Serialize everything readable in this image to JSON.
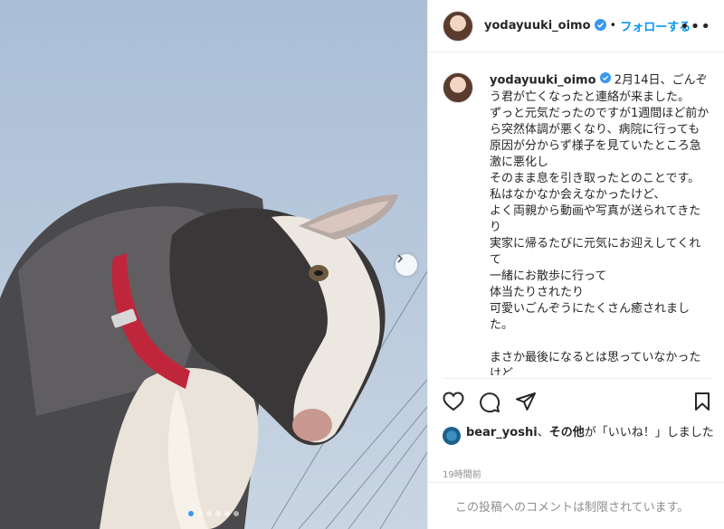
{
  "post": {
    "username": "yodayuuki_oimo",
    "follow_label": "フォローする",
    "separator": "•",
    "more_label": "•••"
  },
  "caption": {
    "username": "yodayuuki_oimo",
    "text": "2月14日、ごんぞう君が亡くなったと連絡が来ました。\nずっと元気だったのですが1週間ほど前から突然体調が悪くなり、病院に行っても原因が分からず様子を見ていたところ急激に悪化し\nそのまま息を引き取ったとのことです。\n私はなかなか会えなかったけど、\nよく両親から動画や写真が送られてきたり\n実家に帰るたびに元気にお迎えしてくれて\n一緒にお散歩に行って\n体当たりされたり\n可愛いごんぞうにたくさん癒されました。\n\nまさか最後になるとは思っていなかったけど"
  },
  "likes": {
    "user": "bear_yoshi",
    "conj": "、",
    "others": "その他",
    "suffix": "が「いいね！」しました"
  },
  "time": "19時間前",
  "comment_disabled": "この投稿へのコメントは制限されています。",
  "carousel": {
    "count": 6,
    "active_index": 0
  },
  "icons": [
    "verified-badge-icon",
    "heart-icon",
    "comment-icon",
    "share-icon",
    "bookmark-icon",
    "chevron-right-icon",
    "more-icon"
  ],
  "colors": {
    "link": "#0095f6",
    "verified": "#3897f0",
    "muted": "#8e8e8e"
  }
}
